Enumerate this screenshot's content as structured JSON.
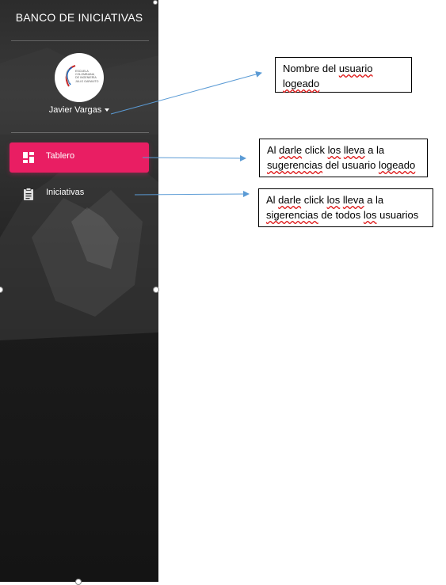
{
  "sidebar": {
    "title": "BANCO DE INICIATIVAS",
    "logo_text": [
      "ESCUELA",
      "COLOMBIANA",
      "DE INGENIERÍA",
      "JULIO GARAVITO"
    ],
    "user_name": "Javier Vargas",
    "items": [
      {
        "label": "Tablero",
        "icon": "dashboard-icon",
        "active": true
      },
      {
        "label": "Iniciativas",
        "icon": "clipboard-icon",
        "active": false
      }
    ],
    "accent_color": "#e91e63"
  },
  "callouts": {
    "user": {
      "parts": [
        "Nombre del ",
        "usuario",
        " ",
        "logeado"
      ]
    },
    "tablero": {
      "line1": [
        "Al ",
        "darle",
        " click ",
        "los",
        " ",
        "lleva",
        " a la"
      ],
      "line2": [
        "sugerencias",
        " del usuario ",
        "logeado"
      ]
    },
    "iniciativas": {
      "line1": [
        "Al ",
        "darle",
        " click ",
        "los",
        " ",
        "lleva",
        " a la"
      ],
      "line2": [
        "sigerencias",
        " de todos ",
        "los",
        " usuarios"
      ]
    }
  },
  "arrow_color": "#5b9bd5"
}
